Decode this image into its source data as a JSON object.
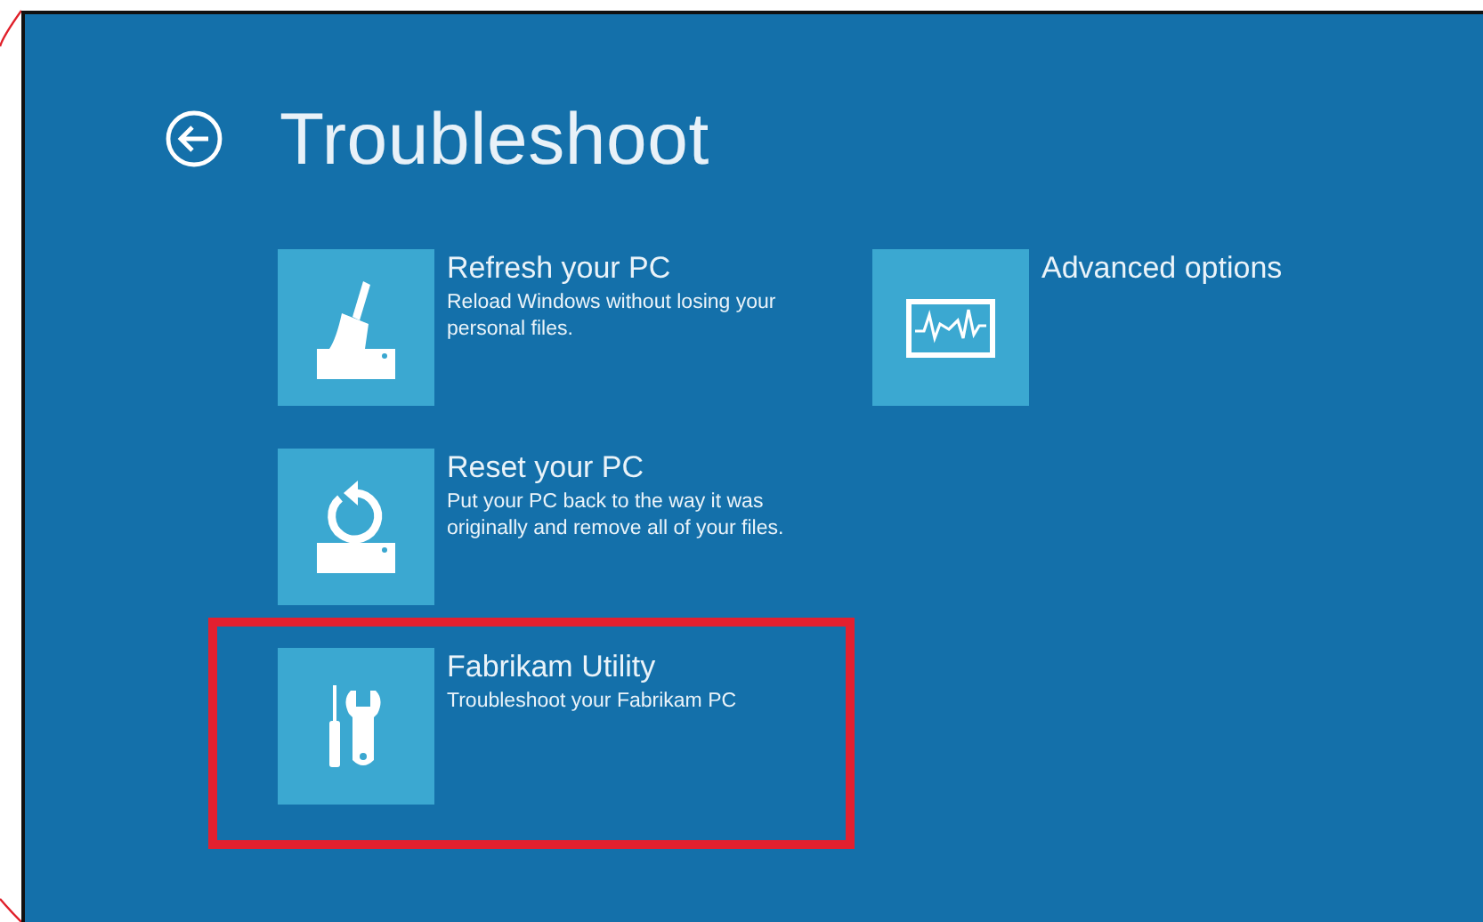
{
  "header": {
    "title": "Troubleshoot"
  },
  "columns": [
    [
      {
        "title": "Refresh your PC",
        "description": "Reload Windows without losing your personal files.",
        "kind": "broom",
        "highlighted": false
      },
      {
        "title": "Reset your PC",
        "description": "Put your PC back to the way it was originally and remove all of your files.",
        "kind": "reset",
        "highlighted": false
      },
      {
        "title": "Fabrikam Utility",
        "description": "Troubleshoot your Fabrikam PC",
        "kind": "tools",
        "highlighted": true
      }
    ],
    [
      {
        "title": "Advanced options",
        "kind": "monitor",
        "highlighted": false
      }
    ]
  ]
}
